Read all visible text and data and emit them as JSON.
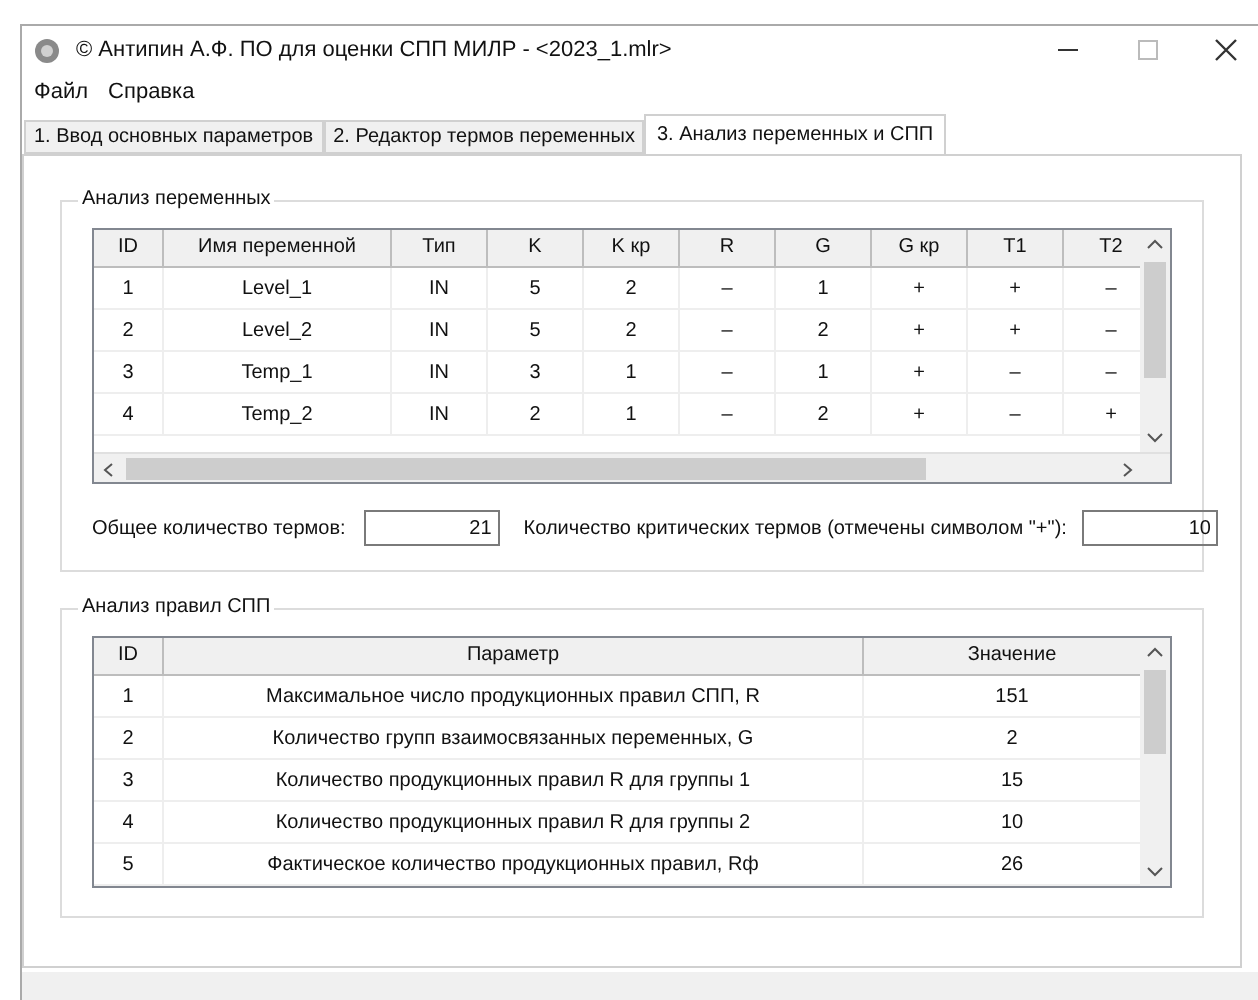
{
  "window": {
    "title": "© Антипин А.Ф. ПО для оценки СПП МИЛР - <2023_1.mlr>"
  },
  "menu": [
    "Файл",
    "Справка"
  ],
  "tabs": [
    {
      "label": "1. Ввод основных параметров",
      "selected": false
    },
    {
      "label": "2. Редактор термов переменных",
      "selected": false
    },
    {
      "label": "3. Анализ переменных и СПП",
      "selected": true
    }
  ],
  "variables_group": {
    "title": "Анализ переменных",
    "columns": [
      "ID",
      "Имя переменной",
      "Тип",
      "K",
      "K кр",
      "R",
      "G",
      "G кр",
      "T1",
      "T2"
    ],
    "rows": [
      [
        "1",
        "Level_1",
        "IN",
        "5",
        "2",
        "–",
        "1",
        "+",
        "+",
        "–"
      ],
      [
        "2",
        "Level_2",
        "IN",
        "5",
        "2",
        "–",
        "2",
        "+",
        "+",
        "–"
      ],
      [
        "3",
        "Temp_1",
        "IN",
        "3",
        "1",
        "–",
        "1",
        "+",
        "–",
        "–"
      ],
      [
        "4",
        "Temp_2",
        "IN",
        "2",
        "1",
        "–",
        "2",
        "+",
        "–",
        "+"
      ]
    ],
    "total_terms": {
      "label": "Общее количество термов:",
      "value": "21"
    },
    "critical_terms": {
      "label": "Количество критических термов (отмечены символом \"+\"):",
      "value": "10"
    }
  },
  "rules_group": {
    "title": "Анализ правил СПП",
    "columns": [
      "ID",
      "Параметр",
      "Значение"
    ],
    "rows": [
      [
        "1",
        "Максимальное число продукционных правил СПП, R",
        "151"
      ],
      [
        "2",
        "Количество групп взаимосвязанных переменных, G",
        "2"
      ],
      [
        "3",
        "Количество продукционных правил R для группы 1",
        "15"
      ],
      [
        "4",
        "Количество продукционных правил R для группы 2",
        "10"
      ],
      [
        "5",
        "Фактическое количество продукционных правил, Rф",
        "26"
      ]
    ]
  }
}
